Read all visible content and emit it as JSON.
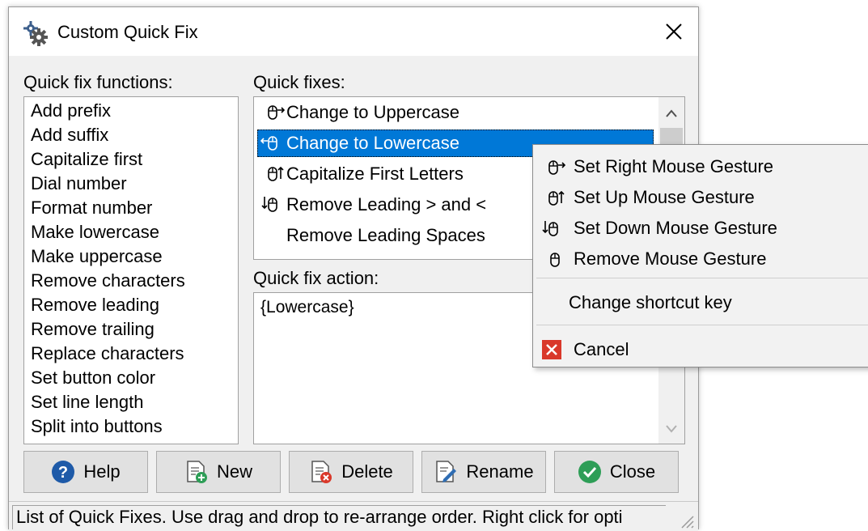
{
  "window": {
    "title": "Custom Quick Fix"
  },
  "functions": {
    "label": "Quick fix functions:",
    "items": [
      "Add prefix",
      "Add suffix",
      "Capitalize first",
      "Dial number",
      "Format number",
      "Make lowercase",
      "Make uppercase",
      "Remove characters",
      "Remove leading",
      "Remove trailing",
      "Replace characters",
      "Set button color",
      "Set line length",
      "Split into buttons"
    ]
  },
  "fixes": {
    "label": "Quick fixes:",
    "items": [
      {
        "label": "Change to Uppercase",
        "gesture": "mouse-right-gesture-icon"
      },
      {
        "label": "Change to Lowercase",
        "gesture": "mouse-left-gesture-icon",
        "selected": true
      },
      {
        "label": "Capitalize First Letters",
        "gesture": "mouse-up-gesture-icon"
      },
      {
        "label": "Remove Leading > and <",
        "gesture": "mouse-down-gesture-icon"
      },
      {
        "label": "Remove Leading Spaces",
        "gesture": ""
      }
    ]
  },
  "action": {
    "label": "Quick fix action:",
    "value": "{Lowercase}"
  },
  "buttons": {
    "help": "Help",
    "new": "New",
    "delete": "Delete",
    "rename": "Rename",
    "close": "Close"
  },
  "status": "List of Quick Fixes. Use drag and drop to re-arrange order. Right click for opti",
  "context_menu": {
    "items": [
      {
        "label": "Set Right Mouse Gesture",
        "icon": "mouse-right-gesture-icon"
      },
      {
        "label": "Set Up Mouse Gesture",
        "icon": "mouse-up-gesture-icon"
      },
      {
        "label": "Set Down Mouse Gesture",
        "icon": "mouse-down-gesture-icon"
      },
      {
        "label": "Remove Mouse Gesture",
        "icon": "mouse-icon"
      },
      {
        "label": "Change shortcut key",
        "icon": ""
      },
      {
        "label": "Cancel",
        "icon": "cancel-icon"
      }
    ]
  },
  "colors": {
    "selection": "#0078d7",
    "help_icon": "#1e5aa8",
    "close_icon": "#2e9e57",
    "cancel_icon": "#d9382a"
  }
}
